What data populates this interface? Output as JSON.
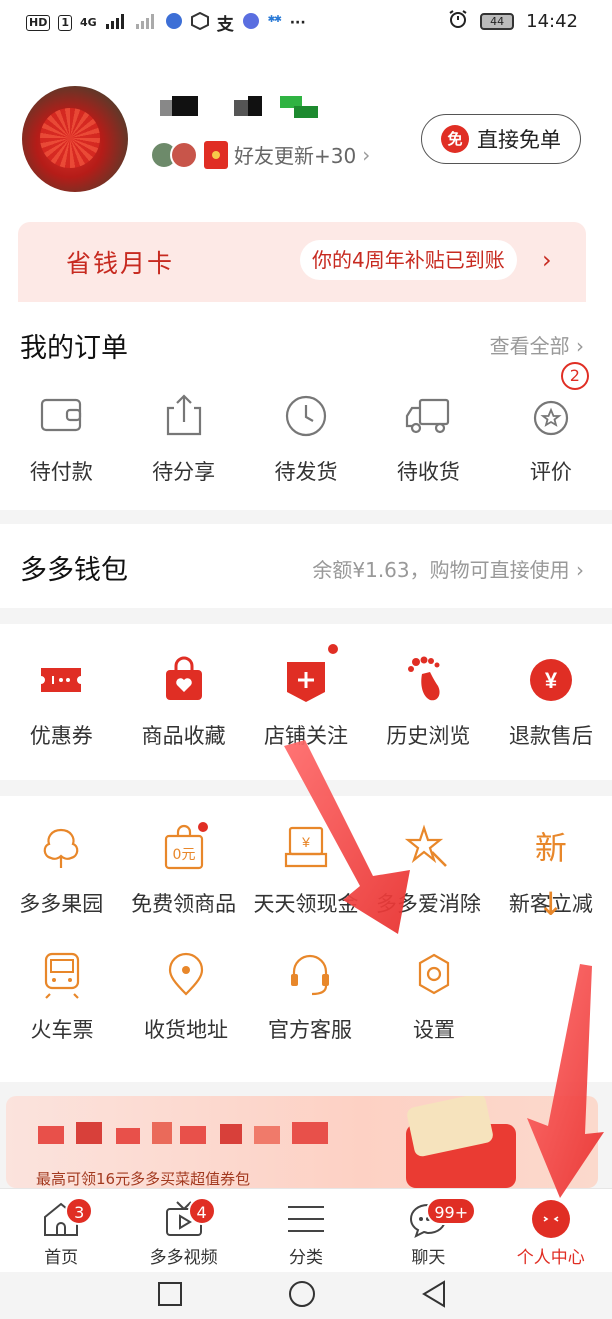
{
  "status_bar": {
    "left_badges": [
      "HD",
      "1"
    ],
    "network": "4G",
    "time": "14:42",
    "battery": "44"
  },
  "profile": {
    "friend_update": "好友更新+30",
    "free_button": "直接免单",
    "free_icon_char": "免"
  },
  "money_card": {
    "title": "省钱月卡",
    "message": "你的4周年补贴已到账",
    "arrow": "›"
  },
  "orders": {
    "title": "我的订单",
    "view_all": "查看全部",
    "items": [
      {
        "label": "待付款",
        "icon": "wallet-icon"
      },
      {
        "label": "待分享",
        "icon": "share-icon"
      },
      {
        "label": "待发货",
        "icon": "clock-icon"
      },
      {
        "label": "待收货",
        "icon": "truck-icon"
      },
      {
        "label": "评价",
        "icon": "review-icon",
        "badge": "2"
      }
    ]
  },
  "wallet": {
    "title": "多多钱包",
    "balance_text": "余额¥1.63，购物可直接使用"
  },
  "quick": {
    "items": [
      {
        "label": "优惠券",
        "icon": "coupon-icon"
      },
      {
        "label": "商品收藏",
        "icon": "bag-heart-icon"
      },
      {
        "label": "店铺关注",
        "icon": "shop-follow-icon"
      },
      {
        "label": "历史浏览",
        "icon": "footprint-icon"
      },
      {
        "label": "退款售后",
        "icon": "refund-icon"
      }
    ]
  },
  "services": {
    "row1": [
      {
        "label": "多多果园",
        "icon": "tree-icon"
      },
      {
        "label": "免费领商品",
        "icon": "free-goods-icon"
      },
      {
        "label": "天天领现金",
        "icon": "cash-icon"
      },
      {
        "label": "多多爱消除",
        "icon": "star-wand-icon"
      },
      {
        "label": "新客立减",
        "icon": "new-customer-icon",
        "glyph": "新↓"
      }
    ],
    "row2": [
      {
        "label": "火车票",
        "icon": "train-icon"
      },
      {
        "label": "收货地址",
        "icon": "location-icon"
      },
      {
        "label": "官方客服",
        "icon": "headset-icon"
      },
      {
        "label": "设置",
        "icon": "gear-icon"
      }
    ]
  },
  "banner": {
    "text": "最高可领16元多多买菜超值券包"
  },
  "tabbar": {
    "tabs": [
      {
        "label": "首页",
        "icon": "home-icon",
        "badge": "3"
      },
      {
        "label": "多多视频",
        "icon": "video-icon",
        "badge": "4"
      },
      {
        "label": "分类",
        "icon": "category-icon"
      },
      {
        "label": "聊天",
        "icon": "chat-icon",
        "badge": "99+"
      },
      {
        "label": "个人中心",
        "icon": "profile-icon",
        "active": true
      }
    ]
  },
  "colors": {
    "brand_red": "#e02e24",
    "service_orange": "#e8872a",
    "arrow_red": "#f04a4a"
  }
}
